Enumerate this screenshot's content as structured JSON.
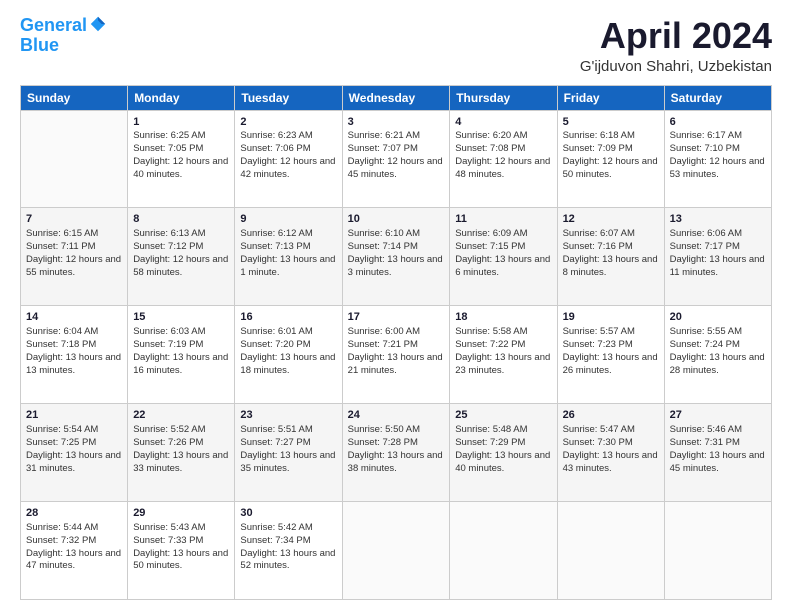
{
  "logo": {
    "line1": "General",
    "line2": "Blue"
  },
  "title": "April 2024",
  "location": "G'ijduvon Shahri, Uzbekistan",
  "days_of_week": [
    "Sunday",
    "Monday",
    "Tuesday",
    "Wednesday",
    "Thursday",
    "Friday",
    "Saturday"
  ],
  "weeks": [
    [
      {
        "day": "",
        "sunrise": "",
        "sunset": "",
        "daylight": ""
      },
      {
        "day": "1",
        "sunrise": "Sunrise: 6:25 AM",
        "sunset": "Sunset: 7:05 PM",
        "daylight": "Daylight: 12 hours and 40 minutes."
      },
      {
        "day": "2",
        "sunrise": "Sunrise: 6:23 AM",
        "sunset": "Sunset: 7:06 PM",
        "daylight": "Daylight: 12 hours and 42 minutes."
      },
      {
        "day": "3",
        "sunrise": "Sunrise: 6:21 AM",
        "sunset": "Sunset: 7:07 PM",
        "daylight": "Daylight: 12 hours and 45 minutes."
      },
      {
        "day": "4",
        "sunrise": "Sunrise: 6:20 AM",
        "sunset": "Sunset: 7:08 PM",
        "daylight": "Daylight: 12 hours and 48 minutes."
      },
      {
        "day": "5",
        "sunrise": "Sunrise: 6:18 AM",
        "sunset": "Sunset: 7:09 PM",
        "daylight": "Daylight: 12 hours and 50 minutes."
      },
      {
        "day": "6",
        "sunrise": "Sunrise: 6:17 AM",
        "sunset": "Sunset: 7:10 PM",
        "daylight": "Daylight: 12 hours and 53 minutes."
      }
    ],
    [
      {
        "day": "7",
        "sunrise": "Sunrise: 6:15 AM",
        "sunset": "Sunset: 7:11 PM",
        "daylight": "Daylight: 12 hours and 55 minutes."
      },
      {
        "day": "8",
        "sunrise": "Sunrise: 6:13 AM",
        "sunset": "Sunset: 7:12 PM",
        "daylight": "Daylight: 12 hours and 58 minutes."
      },
      {
        "day": "9",
        "sunrise": "Sunrise: 6:12 AM",
        "sunset": "Sunset: 7:13 PM",
        "daylight": "Daylight: 13 hours and 1 minute."
      },
      {
        "day": "10",
        "sunrise": "Sunrise: 6:10 AM",
        "sunset": "Sunset: 7:14 PM",
        "daylight": "Daylight: 13 hours and 3 minutes."
      },
      {
        "day": "11",
        "sunrise": "Sunrise: 6:09 AM",
        "sunset": "Sunset: 7:15 PM",
        "daylight": "Daylight: 13 hours and 6 minutes."
      },
      {
        "day": "12",
        "sunrise": "Sunrise: 6:07 AM",
        "sunset": "Sunset: 7:16 PM",
        "daylight": "Daylight: 13 hours and 8 minutes."
      },
      {
        "day": "13",
        "sunrise": "Sunrise: 6:06 AM",
        "sunset": "Sunset: 7:17 PM",
        "daylight": "Daylight: 13 hours and 11 minutes."
      }
    ],
    [
      {
        "day": "14",
        "sunrise": "Sunrise: 6:04 AM",
        "sunset": "Sunset: 7:18 PM",
        "daylight": "Daylight: 13 hours and 13 minutes."
      },
      {
        "day": "15",
        "sunrise": "Sunrise: 6:03 AM",
        "sunset": "Sunset: 7:19 PM",
        "daylight": "Daylight: 13 hours and 16 minutes."
      },
      {
        "day": "16",
        "sunrise": "Sunrise: 6:01 AM",
        "sunset": "Sunset: 7:20 PM",
        "daylight": "Daylight: 13 hours and 18 minutes."
      },
      {
        "day": "17",
        "sunrise": "Sunrise: 6:00 AM",
        "sunset": "Sunset: 7:21 PM",
        "daylight": "Daylight: 13 hours and 21 minutes."
      },
      {
        "day": "18",
        "sunrise": "Sunrise: 5:58 AM",
        "sunset": "Sunset: 7:22 PM",
        "daylight": "Daylight: 13 hours and 23 minutes."
      },
      {
        "day": "19",
        "sunrise": "Sunrise: 5:57 AM",
        "sunset": "Sunset: 7:23 PM",
        "daylight": "Daylight: 13 hours and 26 minutes."
      },
      {
        "day": "20",
        "sunrise": "Sunrise: 5:55 AM",
        "sunset": "Sunset: 7:24 PM",
        "daylight": "Daylight: 13 hours and 28 minutes."
      }
    ],
    [
      {
        "day": "21",
        "sunrise": "Sunrise: 5:54 AM",
        "sunset": "Sunset: 7:25 PM",
        "daylight": "Daylight: 13 hours and 31 minutes."
      },
      {
        "day": "22",
        "sunrise": "Sunrise: 5:52 AM",
        "sunset": "Sunset: 7:26 PM",
        "daylight": "Daylight: 13 hours and 33 minutes."
      },
      {
        "day": "23",
        "sunrise": "Sunrise: 5:51 AM",
        "sunset": "Sunset: 7:27 PM",
        "daylight": "Daylight: 13 hours and 35 minutes."
      },
      {
        "day": "24",
        "sunrise": "Sunrise: 5:50 AM",
        "sunset": "Sunset: 7:28 PM",
        "daylight": "Daylight: 13 hours and 38 minutes."
      },
      {
        "day": "25",
        "sunrise": "Sunrise: 5:48 AM",
        "sunset": "Sunset: 7:29 PM",
        "daylight": "Daylight: 13 hours and 40 minutes."
      },
      {
        "day": "26",
        "sunrise": "Sunrise: 5:47 AM",
        "sunset": "Sunset: 7:30 PM",
        "daylight": "Daylight: 13 hours and 43 minutes."
      },
      {
        "day": "27",
        "sunrise": "Sunrise: 5:46 AM",
        "sunset": "Sunset: 7:31 PM",
        "daylight": "Daylight: 13 hours and 45 minutes."
      }
    ],
    [
      {
        "day": "28",
        "sunrise": "Sunrise: 5:44 AM",
        "sunset": "Sunset: 7:32 PM",
        "daylight": "Daylight: 13 hours and 47 minutes."
      },
      {
        "day": "29",
        "sunrise": "Sunrise: 5:43 AM",
        "sunset": "Sunset: 7:33 PM",
        "daylight": "Daylight: 13 hours and 50 minutes."
      },
      {
        "day": "30",
        "sunrise": "Sunrise: 5:42 AM",
        "sunset": "Sunset: 7:34 PM",
        "daylight": "Daylight: 13 hours and 52 minutes."
      },
      {
        "day": "",
        "sunrise": "",
        "sunset": "",
        "daylight": ""
      },
      {
        "day": "",
        "sunrise": "",
        "sunset": "",
        "daylight": ""
      },
      {
        "day": "",
        "sunrise": "",
        "sunset": "",
        "daylight": ""
      },
      {
        "day": "",
        "sunrise": "",
        "sunset": "",
        "daylight": ""
      }
    ]
  ]
}
